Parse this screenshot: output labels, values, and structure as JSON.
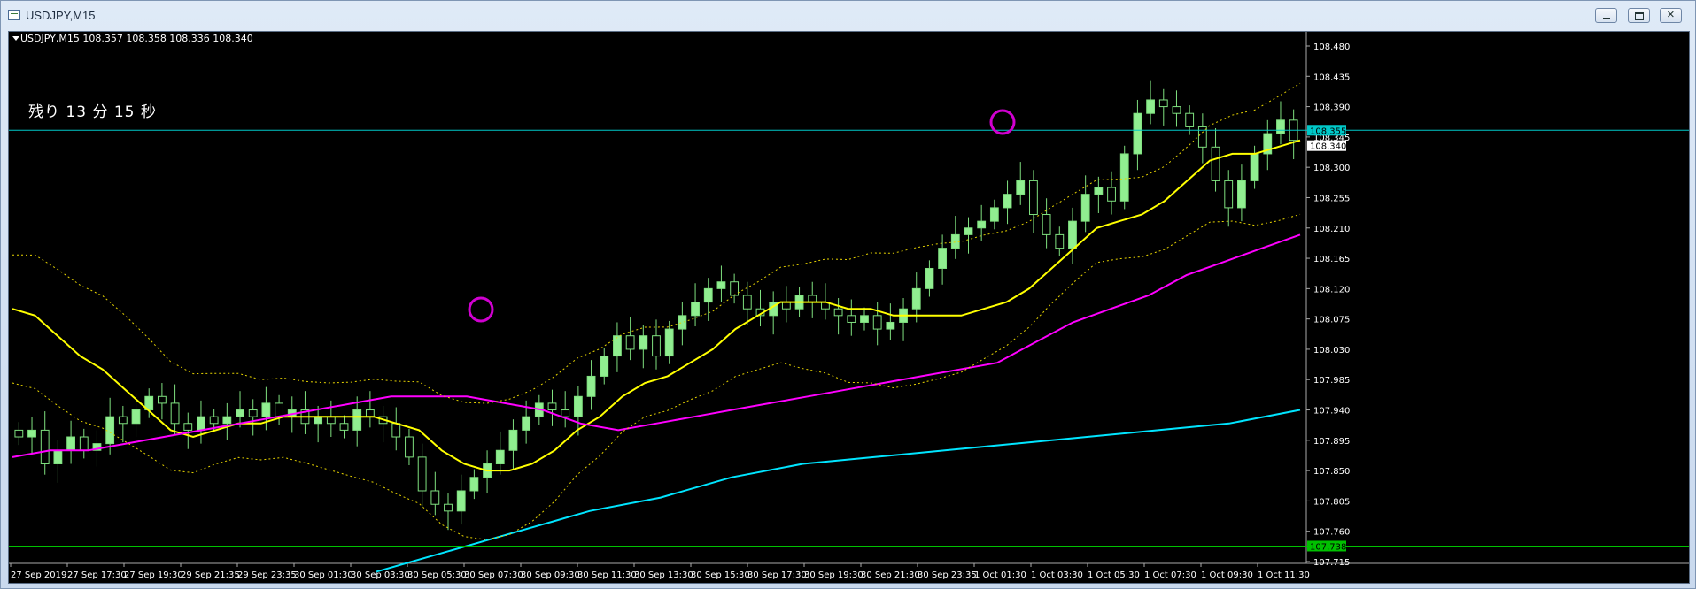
{
  "window": {
    "title": "USDJPY,M15",
    "controls": [
      "minimize",
      "restore",
      "close"
    ]
  },
  "chart_header": {
    "label": "USDJPY,M15  108.357 108.358 108.336 108.340"
  },
  "timer_overlay": "残り 13 分 15 秒",
  "chart_data": {
    "type": "candlestick",
    "symbol": "USDJPY",
    "timeframe": "M15",
    "ohlc_current": {
      "open": 108.357,
      "high": 108.358,
      "low": 108.336,
      "close": 108.34
    },
    "y_ticks": [
      108.48,
      108.435,
      108.39,
      108.345,
      108.3,
      108.255,
      108.21,
      108.165,
      108.12,
      108.075,
      108.03,
      107.985,
      107.94,
      107.895,
      107.85,
      107.805,
      107.76,
      107.715
    ],
    "x_ticks": [
      "27 Sep 2019",
      "27 Sep 17:30",
      "27 Sep 19:30",
      "29 Sep 21:35",
      "29 Sep 23:35",
      "30 Sep 01:30",
      "30 Sep 03:30",
      "30 Sep 05:30",
      "30 Sep 07:30",
      "30 Sep 09:30",
      "30 Sep 11:30",
      "30 Sep 13:30",
      "30 Sep 15:30",
      "30 Sep 17:30",
      "30 Sep 19:30",
      "30 Sep 21:30",
      "30 Sep 23:35",
      "1 Oct 01:30",
      "1 Oct 03:30",
      "1 Oct 05:30",
      "1 Oct 07:30",
      "1 Oct 09:30",
      "1 Oct 11:30"
    ],
    "price_levels": [
      {
        "value": 108.355,
        "label": "108.355",
        "color": "#00c8c8"
      },
      {
        "value": 108.34,
        "label": "108.340",
        "color": "#ffffff"
      },
      {
        "value": 107.738,
        "label": "107.738",
        "color": "#00c000"
      }
    ],
    "close_series": [
      107.9,
      107.91,
      107.86,
      107.88,
      107.9,
      107.88,
      107.89,
      107.93,
      107.92,
      107.94,
      107.96,
      107.95,
      107.92,
      107.91,
      107.93,
      107.92,
      107.93,
      107.94,
      107.93,
      107.95,
      107.93,
      107.94,
      107.92,
      107.93,
      107.92,
      107.91,
      107.94,
      107.93,
      107.92,
      107.9,
      107.87,
      107.82,
      107.8,
      107.79,
      107.82,
      107.84,
      107.86,
      107.88,
      107.91,
      107.93,
      107.95,
      107.94,
      107.93,
      107.96,
      107.99,
      108.02,
      108.05,
      108.03,
      108.05,
      108.02,
      108.06,
      108.08,
      108.1,
      108.12,
      108.13,
      108.11,
      108.09,
      108.08,
      108.1,
      108.09,
      108.11,
      108.1,
      108.09,
      108.08,
      108.07,
      108.08,
      108.06,
      108.07,
      108.09,
      108.12,
      108.15,
      108.18,
      108.2,
      108.21,
      108.22,
      108.24,
      108.26,
      108.28,
      108.23,
      108.2,
      108.18,
      108.22,
      108.26,
      108.27,
      108.25,
      108.32,
      108.38,
      108.4,
      108.39,
      108.38,
      108.36,
      108.33,
      108.28,
      108.24,
      108.28,
      108.32,
      108.35,
      108.37,
      108.34
    ],
    "indicators": [
      {
        "type": "Moving Average",
        "color": "#ffff00",
        "values": [
          108.09,
          108.08,
          108.05,
          108.02,
          108.0,
          107.97,
          107.94,
          107.91,
          107.9,
          107.91,
          107.92,
          107.92,
          107.93,
          107.93,
          107.93,
          107.93,
          107.93,
          107.92,
          107.91,
          107.88,
          107.86,
          107.85,
          107.85,
          107.86,
          107.88,
          107.91,
          107.93,
          107.96,
          107.98,
          107.99,
          108.01,
          108.03,
          108.06,
          108.08,
          108.1,
          108.1,
          108.1,
          108.09,
          108.09,
          108.08,
          108.08,
          108.08,
          108.08,
          108.09,
          108.1,
          108.12,
          108.15,
          108.18,
          108.21,
          108.22,
          108.23,
          108.25,
          108.28,
          108.31,
          108.32,
          108.32,
          108.33,
          108.34
        ]
      },
      {
        "type": "Moving Average",
        "color": "#ff00ff",
        "values": [
          107.87,
          107.88,
          107.88,
          107.89,
          107.9,
          107.91,
          107.92,
          107.93,
          107.94,
          107.95,
          107.96,
          107.96,
          107.96,
          107.95,
          107.94,
          107.92,
          107.91,
          107.92,
          107.93,
          107.94,
          107.95,
          107.96,
          107.97,
          107.98,
          107.99,
          108.0,
          108.01,
          108.04,
          108.07,
          108.09,
          108.11,
          108.14,
          108.16,
          108.18,
          108.2
        ]
      },
      {
        "type": "Moving Average",
        "color": "#00e5ff",
        "values": [
          107.7,
          107.73,
          107.76,
          107.79,
          107.81,
          107.84,
          107.86,
          107.87,
          107.88,
          107.89,
          107.9,
          107.91,
          107.92,
          107.94
        ]
      },
      {
        "type": "Bollinger Bands",
        "color": "#e6d300",
        "style": "dotted"
      }
    ],
    "annotations": [
      {
        "type": "circle",
        "color": "#d000d0"
      },
      {
        "type": "circle",
        "color": "#d000d0"
      }
    ],
    "colors": {
      "background": "#000000",
      "bull": "#90ee90",
      "bear": "#000000",
      "grid": "none"
    }
  }
}
